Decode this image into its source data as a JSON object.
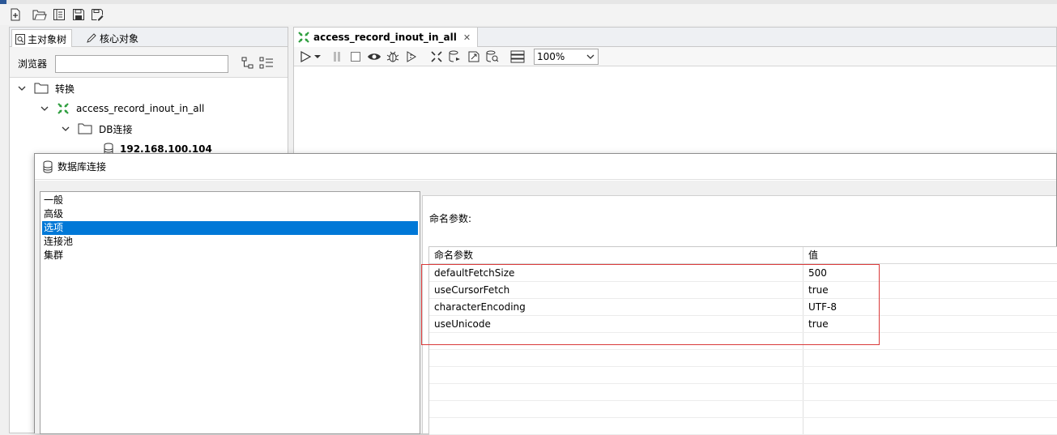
{
  "toolbar": {
    "buttons": [
      "new-file-icon",
      "open-folder-icon",
      "explore-repository-icon",
      "save-icon",
      "save-as-icon"
    ]
  },
  "left_panel": {
    "tabs": [
      {
        "label": "主对象树",
        "icon": "tree-icon",
        "active": true
      },
      {
        "label": "核心对象",
        "icon": "pencil-icon",
        "active": false
      }
    ],
    "browser_label": "浏览器",
    "browser_value": "",
    "tree": [
      {
        "label": "转换",
        "level": 0,
        "icon": "folder-icon"
      },
      {
        "label": "access_record_inout_in_all",
        "level": 1,
        "icon": "transformation-icon"
      },
      {
        "label": "DB连接",
        "level": 2,
        "icon": "folder-icon"
      },
      {
        "label": "192.168.100.104",
        "level": 3,
        "icon": "database-icon"
      }
    ]
  },
  "editor": {
    "tab_label": "access_record_inout_in_all",
    "zoom": "100%"
  },
  "dialog": {
    "title": "数据库连接",
    "categories": [
      "一般",
      "高级",
      "选项",
      "连接池",
      "集群"
    ],
    "selected_category": "选项",
    "params_label": "命名参数:",
    "table": {
      "headers": [
        "命名参数",
        "值"
      ],
      "rows": [
        {
          "name": "defaultFetchSize",
          "value": "500"
        },
        {
          "name": "useCursorFetch",
          "value": "true"
        },
        {
          "name": "characterEncoding",
          "value": "UTF-8"
        },
        {
          "name": "useUnicode",
          "value": "true"
        }
      ]
    }
  },
  "colors": {
    "selection": "#0078d7",
    "highlight_box": "#d93a3a",
    "transformation_icon": "#2e9e3e"
  }
}
